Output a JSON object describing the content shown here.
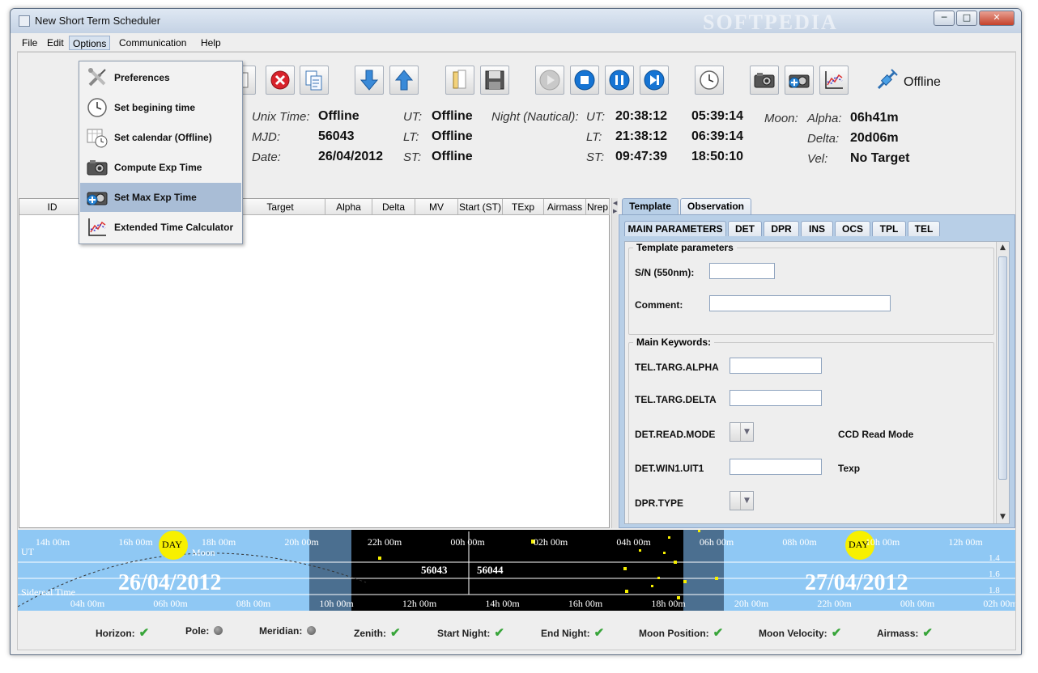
{
  "window": {
    "title": "New Short Term Scheduler",
    "watermark": "SOFTPEDIA"
  },
  "menubar": {
    "items": [
      "File",
      "Edit",
      "Options",
      "Communication",
      "Help"
    ],
    "active": "Options"
  },
  "options_menu": {
    "items": [
      "Preferences",
      "Set begining time",
      "Set calendar (Offline)",
      "Compute Exp Time",
      "Set Max Exp Time",
      "Extended Time Calculator"
    ],
    "highlighted": "Set Max Exp Time"
  },
  "toolbar": {
    "status_label": "Offline"
  },
  "time_info": {
    "unix_time_label": "Unix Time:",
    "unix_time_value": "Offline",
    "mjd_label": "MJD:",
    "mjd_value": "56043",
    "date_label": "Date:",
    "date_value": "26/04/2012",
    "ut_label": "UT:",
    "ut_value": "Offline",
    "lt_label": "LT:",
    "lt_value": "Offline",
    "st_label": "ST:",
    "st_value": "Offline",
    "night_label": "Night (Nautical):",
    "night_ut_label": "UT:",
    "night_ut_start": "20:38:12",
    "night_ut_end": "05:39:14",
    "night_lt_label": "LT:",
    "night_lt_start": "21:38:12",
    "night_lt_end": "06:39:14",
    "night_st_label": "ST:",
    "night_st_start": "09:47:39",
    "night_st_end": "18:50:10",
    "moon_label": "Moon:",
    "alpha_label": "Alpha:",
    "alpha_value": "06h41m",
    "delta_label": "Delta:",
    "delta_value": "20d06m",
    "vel_label": "Vel:",
    "vel_value": "No Target"
  },
  "table": {
    "columns": [
      "ID",
      "Target",
      "Alpha",
      "Delta",
      "MV",
      "Start (ST)",
      "TExp",
      "Airmass",
      "Nrep"
    ]
  },
  "right_panel": {
    "tabs": [
      "Template",
      "Observation"
    ],
    "active_tab": "Template",
    "subtabs": [
      "MAIN PARAMETERS",
      "DET",
      "DPR",
      "INS",
      "OCS",
      "TPL",
      "TEL"
    ],
    "active_subtab": "MAIN PARAMETERS",
    "template_group": "Template parameters",
    "sn_label": "S/N (550nm):",
    "sn_value": "",
    "comment_label": "Comment:",
    "comment_value": "",
    "keywords_group": "Main Keywords:",
    "targ_alpha_label": "TEL.TARG.ALPHA",
    "targ_alpha_value": "",
    "targ_delta_label": "TEL.TARG.DELTA",
    "targ_delta_value": "",
    "read_mode_label": "DET.READ.MODE",
    "read_mode_desc": "CCD Read Mode",
    "win_label": "DET.WIN1.UIT1",
    "win_value": "",
    "win_desc": "Texp",
    "dpr_type_label": "DPR.TYPE"
  },
  "timeline": {
    "ut_label": "UT",
    "moon_label": "Moon",
    "sidereal_label": "Sidereal Time",
    "day_label": "DAY",
    "date_left": "26/04/2012",
    "date_right": "27/04/2012",
    "mjd_left": "56043",
    "mjd_right": "56044",
    "top_ticks": [
      "14h 00m",
      "16h 00m",
      "18h 00m",
      "20h 00m",
      "22h 00m",
      "00h 00m",
      "02h 00m",
      "04h 00m",
      "06h 00m",
      "08h 00m",
      "10h 00m",
      "12h 00m"
    ],
    "bottom_ticks": [
      "04h 00m",
      "06h 00m",
      "08h 00m",
      "10h 00m",
      "12h 00m",
      "14h 00m",
      "16h 00m",
      "18h 00m",
      "20h 00m",
      "22h 00m",
      "00h 00m",
      "02h 00m"
    ],
    "airmass_ticks": [
      "1.4",
      "1.6",
      "1.8"
    ]
  },
  "status_checks": [
    {
      "label": "Horizon:",
      "state": "ok"
    },
    {
      "label": "Pole:",
      "state": "neutral"
    },
    {
      "label": "Meridian:",
      "state": "neutral"
    },
    {
      "label": "Zenith:",
      "state": "ok"
    },
    {
      "label": "Start Night:",
      "state": "ok"
    },
    {
      "label": "End Night:",
      "state": "ok"
    },
    {
      "label": "Moon Position:",
      "state": "ok"
    },
    {
      "label": "Moon Velocity:",
      "state": "ok"
    },
    {
      "label": "Airmass:",
      "state": "ok"
    }
  ],
  "colors": {
    "day_sky": "#8fc8f4",
    "twilight": "#3b5f80",
    "night": "#000000",
    "sun": "#f7f000",
    "accent_blue": "#1a72c6"
  }
}
